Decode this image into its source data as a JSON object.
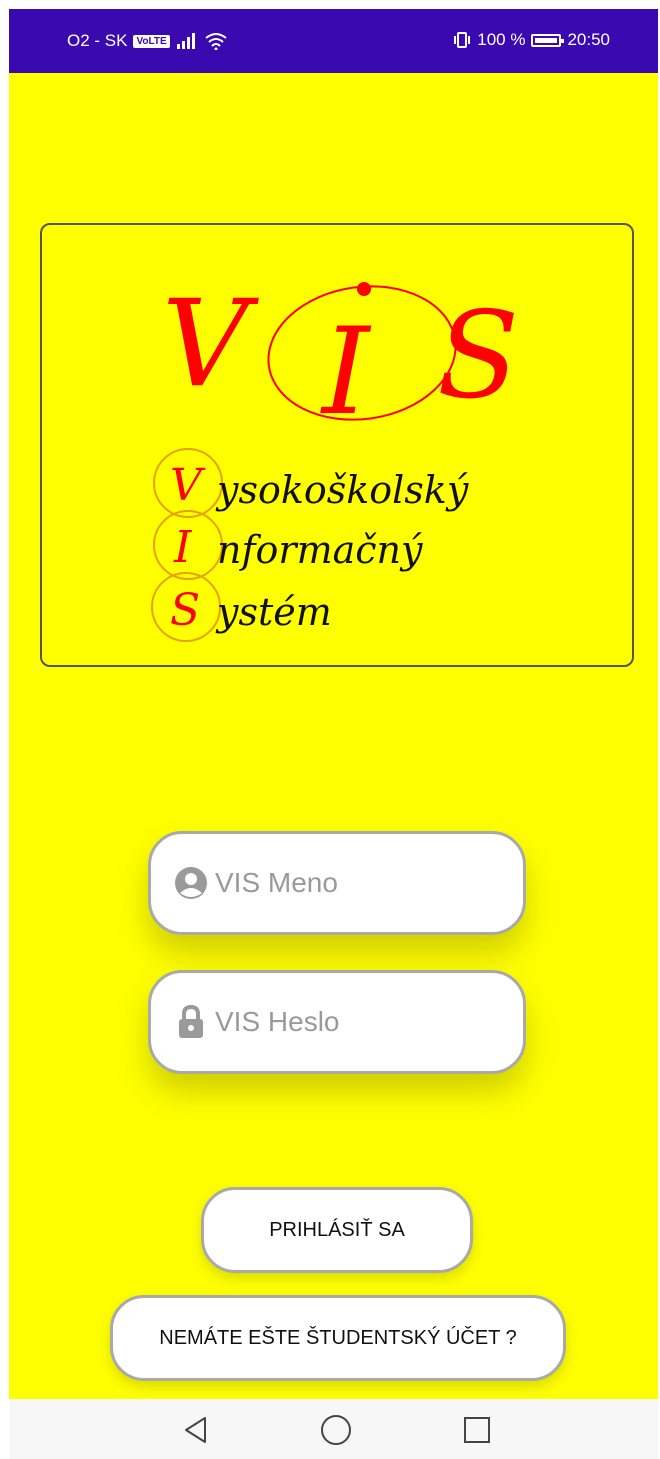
{
  "status_bar": {
    "carrier": "O2 - SK",
    "volte": "VoLTE",
    "battery_percent": "100 %",
    "time": "20:50"
  },
  "logo": {
    "letters": [
      "V",
      "I",
      "S"
    ],
    "line1_initial": "V",
    "line1_rest": "ysokoškolský",
    "line2_initial": "I",
    "line2_rest": "nformačný",
    "line3_initial": "S",
    "line3_rest": "ystém"
  },
  "login": {
    "username_placeholder": "VIS Meno",
    "password_placeholder": "VIS Heslo",
    "login_button": "PRIHLÁSIŤ SA",
    "register_button": "NEMÁTE EŠTE ŠTUDENTSKÝ ÚČET ?"
  },
  "navigation_bar": {
    "back_icon": "back-triangle-icon",
    "home_icon": "home-circle-icon",
    "recents_icon": "recents-square-icon"
  },
  "colors": {
    "background": "#ffff00",
    "status_bar": "#3a0ab0",
    "logo_red": "#ff0000",
    "field_border": "#a9a9a9"
  }
}
